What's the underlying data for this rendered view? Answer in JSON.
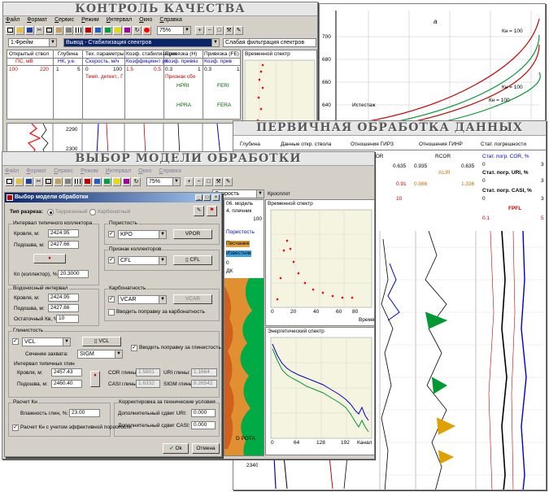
{
  "plot_window": {
    "subplot_letter": "а",
    "y_ticks": [
      "700",
      "680",
      "660",
      "640"
    ],
    "labels": [
      "Кн = 100",
      "Кн = 100",
      "Кн = 100",
      "Истестаж"
    ]
  },
  "quality": {
    "banner": "КОНТРОЛЬ КАЧЕСТВА",
    "menu": [
      "Файл",
      "Формат",
      "Сервис",
      "Режим",
      "Интервал",
      "Окно",
      "Справка"
    ],
    "zoom": "75%",
    "well_combo": "1:Фрейм",
    "mode_combo": "Вывод - Стабилизация спектров",
    "filter_combo": "Слабая фильтрация спектров",
    "columns": [
      {
        "h": "Открытый ствол",
        "u": "ПС, мВ"
      },
      {
        "h": "Глубина",
        "u": "НК, у.е."
      },
      {
        "h": "Тех. параметры",
        "u": "Скорость, м/ч"
      },
      {
        "h": "Коэф. стабилизации",
        "u": "Коэффициент ра"
      },
      {
        "h": "Привязка (Н)",
        "u": "Коэф. привяз"
      },
      {
        "h": "Привязка (FE)",
        "u": "Коэф. прив"
      }
    ],
    "row1": [
      "100",
      "220",
      "1",
      "5",
      "0",
      "100",
      "1.5",
      "0.5",
      "0.3",
      "1",
      "0.3",
      "1"
    ],
    "extra": [
      "Темп. детект., Г",
      "Признак сбо",
      "HPRI",
      "FERI",
      "HPRA",
      "FERA"
    ],
    "spectrum_title": "Временной спектр",
    "depths": [
      "2290",
      "2300"
    ]
  },
  "primary": {
    "banner": "ПЕРВИЧНАЯ ОБРАБОТКА ДАННЫХ",
    "headers": [
      "Глубина",
      "Данные откр. ствола",
      "Отношения ГИРЗ",
      "Отношения ГИНР",
      "Стат. погрешности"
    ],
    "col_labels": [
      "ROR",
      "RCOR",
      "ALIR"
    ],
    "values": [
      "0.635",
      "0.935",
      "0.635",
      "0.91",
      "0.986",
      "1.336",
      "10",
      "0",
      "3"
    ],
    "stat_labels": [
      "Стат. погр. COR, %",
      "Стат. погр. URI, %",
      "Стат. погр. CASI, %",
      "FPFL"
    ],
    "stat_vals": [
      "0",
      "3",
      "0",
      "3",
      "0",
      "3",
      "0.1",
      "5"
    ],
    "depth": "2340"
  },
  "model": {
    "banner": "ВЫБОР МОДЕЛИ ОБРАБОТКИ",
    "zoom": "75%",
    "mini_combo": "Скорость",
    "panel_texts": [
      "06. модель",
      "4. плечник",
      "Пористость",
      "Песчаник",
      "Известняк",
      "ДК",
      "Кросплот",
      "D РОТА"
    ],
    "panel_ticks": [
      "100",
      "0"
    ],
    "spectrum_title": "Временной спектр",
    "spectrum_ticks": [
      "0",
      "20",
      "40",
      "60",
      "80"
    ],
    "spectrum_xlabel": "Время",
    "energy_title": "Энергетический спектр",
    "energy_ticks": [
      "0",
      "64",
      "128",
      "192"
    ],
    "energy_xlabel": "Канал"
  },
  "dialog": {
    "title": "Выбор модели обработки",
    "section_type_label": "Тип разреза:",
    "radio_terrigen": "Терригенный",
    "radio_carbonate": "Карбонатный",
    "interval": {
      "title": "Интервал типичного коллектора",
      "roof_label": "Кровля, м:",
      "roof_val": "2424.95",
      "base_label": "Подошва, м:",
      "base_val": "2427.66",
      "kp_label": "Кп (коллектор), %:",
      "kp_val": "20.3000"
    },
    "porosity": {
      "title": "Пористость",
      "combo": "KPO",
      "button": "VPOR"
    },
    "collector": {
      "title": "Признак коллекторов",
      "combo": "CFL",
      "button": "CFL"
    },
    "water": {
      "title": "Водоносный интервал",
      "roof_label": "Кровля, м:",
      "roof_val": "2424.95",
      "base_label": "Подошва, м:",
      "base_val": "2427.66",
      "kv_label": "Остаточный Кв, %:",
      "kv_val": "10"
    },
    "carbonate": {
      "title": "Карбонатность",
      "combo": "VCAR",
      "button": "VCAR",
      "check": "Вводить поправку за карбонатность"
    },
    "clay": {
      "title": "Глинистость",
      "combo": "VCL",
      "button": "VCL",
      "check": "Вводить поправку за глинистость",
      "stream_label": "Сечение захвата:",
      "stream_val": "SIGM",
      "sub_title": "Интервал типичных глин",
      "roof_label": "Кровля, м:",
      "roof_val": "2457.43",
      "base_label": "Подошва, м:",
      "base_val": "2460.40",
      "cor_label": "COR глины:",
      "cor_val": "1.5801",
      "uri_label": "URI глины:",
      "uri_val": "1.1664",
      "casi_label": "CASI глины:",
      "casi_val": "1.6332",
      "sigm_label": "SIGM глины:",
      "sigm_val": "8.26542"
    },
    "kn": {
      "title": "Расчет Кн",
      "wet_label": "Влажность глин, %:",
      "wet_val": "23.00",
      "check": "Расчет Кн с учетом эффективной пористости"
    },
    "tech": {
      "title": "Корректировка за технические условия",
      "uri_label": "Дополнительный сдвиг URI:",
      "uri_val": "0.000",
      "casi_label": "Дополнительный сдвиг CASI:",
      "casi_val": "0.000"
    },
    "ok": "Ok",
    "cancel": "Отмена"
  },
  "colors": {
    "spectrum_red": "#ff0000",
    "curve_green": "#009933",
    "curve_blue": "#0000cc",
    "title_blue": "#0a246a"
  }
}
